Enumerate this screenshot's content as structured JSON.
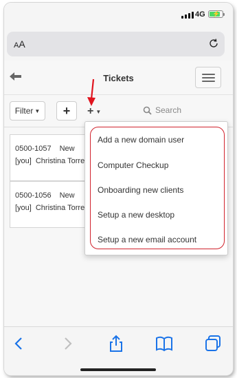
{
  "status_bar": {
    "network": "4G",
    "battery_level": 0.85
  },
  "browser": {
    "text_size_label_small": "A",
    "text_size_label_large": "A",
    "reload_icon": "reload-icon"
  },
  "page": {
    "title": "Tickets",
    "toolbar": {
      "filter_label": "Filter",
      "add_label": "+",
      "template_label": "+",
      "search_placeholder": "Search"
    },
    "tickets": [
      {
        "id": "0500-1057",
        "status": "New",
        "assignee_prefix": "[you]",
        "assignee": "Christina Torres"
      },
      {
        "id": "0500-1056",
        "status": "New",
        "assignee_prefix": "[you]",
        "assignee": "Christina Torres"
      }
    ],
    "template_menu": {
      "items": [
        "Add a new domain user",
        "Computer Checkup",
        "Onboarding new clients",
        "Setup a new desktop",
        "Setup a new email account"
      ]
    }
  },
  "annotations": {
    "highlight_color": "#d0202a",
    "arrow_color": "#e0141e"
  },
  "bottom_bar": {
    "icons": [
      "back-icon",
      "forward-icon",
      "share-icon",
      "bookmarks-icon",
      "tabs-icon"
    ]
  }
}
